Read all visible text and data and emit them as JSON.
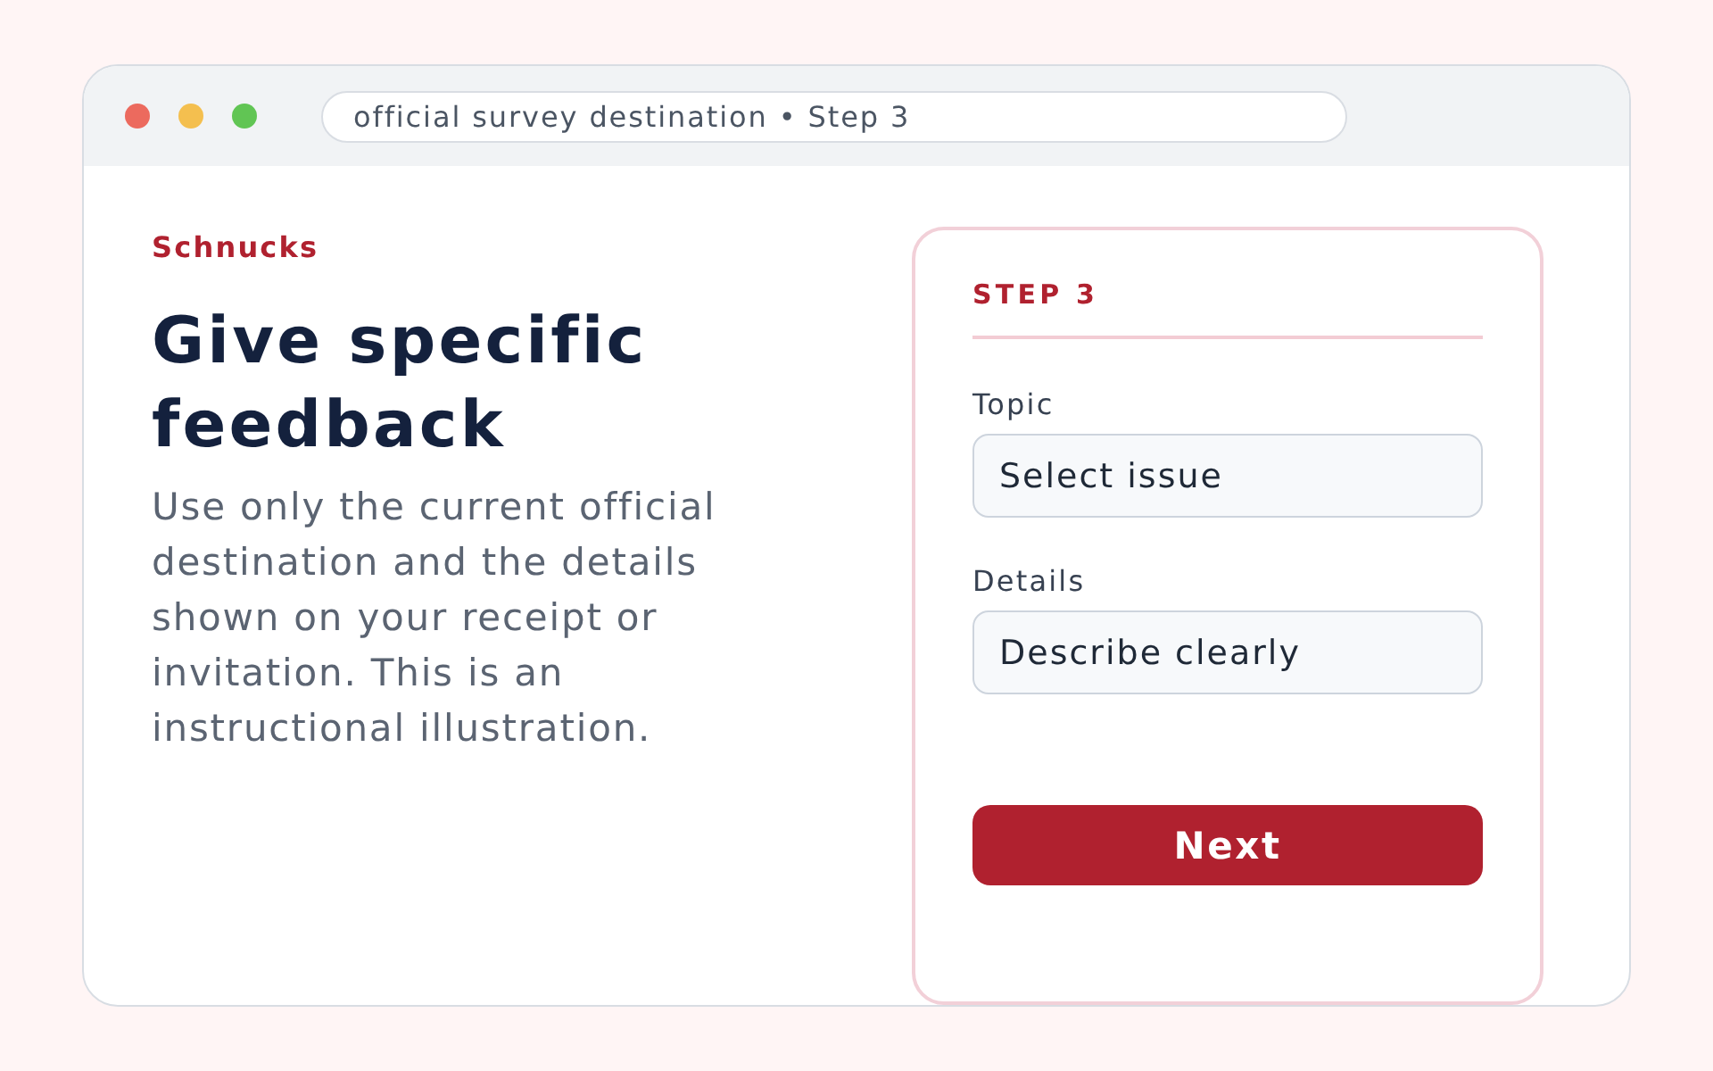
{
  "browser": {
    "address": "official survey destination • Step 3"
  },
  "intro": {
    "brand": "Schnucks",
    "title": "Give specific feedback",
    "body": "Use only the current official destination and the details shown on your receipt or invitation. This is an instructional illustration."
  },
  "form": {
    "step": "STEP 3",
    "fields": [
      {
        "label": "Topic",
        "placeholder": "Select issue"
      },
      {
        "label": "Details",
        "placeholder": "Describe clearly"
      }
    ],
    "button": "Next"
  }
}
